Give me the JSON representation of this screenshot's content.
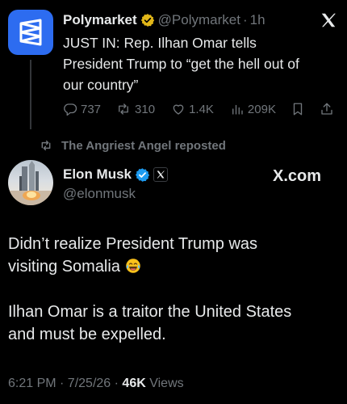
{
  "quoted_post": {
    "author_name": "Polymarket",
    "handle": "@Polymarket",
    "time": "1h",
    "text_lines": [
      "JUST IN: Rep. Ilhan Omar tells",
      "President Trump to “get the hell out of",
      "our country”"
    ],
    "stats": {
      "replies": "737",
      "reposts": "310",
      "likes": "1.4K",
      "views": "209K"
    }
  },
  "repost_label": "The Angriest Angel reposted",
  "post": {
    "author_name": "Elon Musk",
    "handle": "@elonmusk",
    "watermark": "X.com",
    "paragraphs": [
      [
        "Didn’t realize President Trump was",
        "visiting Somalia"
      ],
      [
        "Ilhan Omar is a traitor the United States",
        "and must be expelled."
      ]
    ],
    "timestamp": "6:21 PM · 7/25/26",
    "views_count": "46K",
    "views_label": "Views"
  },
  "icons": {
    "polymarket-logo": "polymarket-logo-icon",
    "verified-gold": "gold-verified-badge-icon",
    "verified-blue": "blue-verified-badge-icon",
    "x": "x-logo-icon",
    "emoji": "laughing-tears-emoji-icon"
  },
  "colors": {
    "background": "#000000",
    "text": "#e7e9ea",
    "muted": "#71767b",
    "polymarket_blue": "#2d6cf0",
    "verified_blue": "#1d9bf0",
    "verified_gold": "#e2b719"
  }
}
